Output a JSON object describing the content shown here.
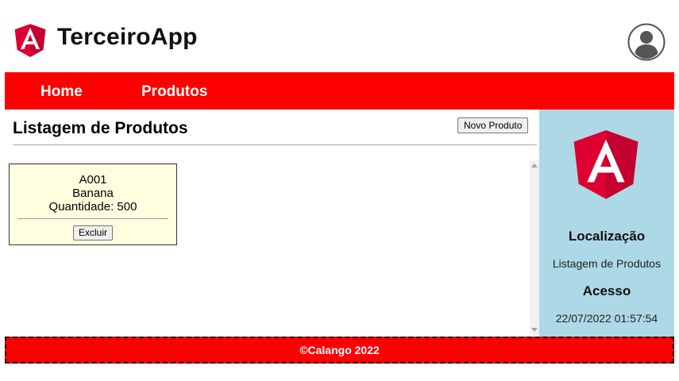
{
  "header": {
    "app_title": "TerceiroApp",
    "logo_icon": "angular-logo-icon",
    "avatar_icon": "user-avatar-icon"
  },
  "nav": {
    "items": [
      {
        "label": "Home"
      },
      {
        "label": "Produtos"
      }
    ]
  },
  "main": {
    "title": "Listagem de Produtos",
    "new_button": "Novo Produto",
    "products": [
      {
        "code": "A001",
        "name": "Banana",
        "quantity_text": "Quantidade: 500",
        "delete_label": "Excluir"
      }
    ]
  },
  "sidebar": {
    "location_heading": "Localização",
    "location_value": "Listagem de Produtos",
    "access_heading": "Acesso",
    "access_value": "22/07/2022 01:57:54"
  },
  "footer": {
    "text": "©Calango 2022"
  },
  "colors": {
    "brand_red": "#ff0000",
    "sidebar_bg": "#add8e6",
    "card_bg": "#ffffe0",
    "angular_red": "#dd0031",
    "angular_dark": "#c3002f"
  }
}
